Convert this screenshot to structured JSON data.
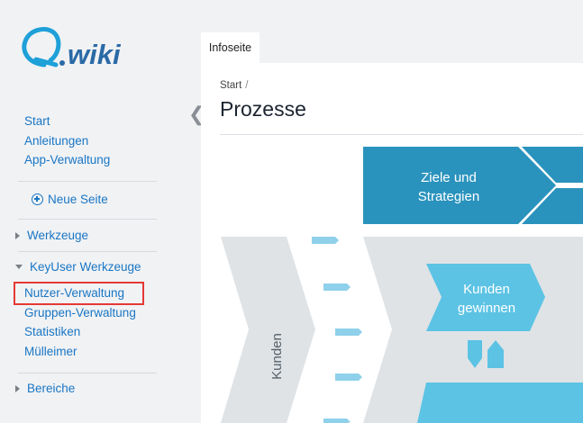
{
  "brand": {
    "logo_text": "Q.wiki"
  },
  "sidebar": {
    "main_links": [
      "Start",
      "Anleitungen",
      "App-Verwaltung"
    ],
    "new_page_label": "Neue Seite",
    "sections": {
      "werkzeuge": "Werkzeuge",
      "keyuser": "KeyUser Werkzeuge",
      "bereiche": "Bereiche"
    },
    "keyuser_items": [
      "Nutzer-Verwaltung",
      "Gruppen-Verwaltung",
      "Statistiken",
      "Mülleimer"
    ],
    "highlighted_item": "Nutzer-Verwaltung"
  },
  "collapse_glyph": "❮",
  "tab": {
    "label": "Infoseite"
  },
  "main": {
    "breadcrumb": {
      "start": "Start",
      "separator": "/"
    },
    "title": "Prozesse"
  },
  "diagram": {
    "goals_line1": "Ziele und",
    "goals_line2": "Strategien",
    "customer_label": "Kunden",
    "win_line1": "Kunden",
    "win_line2": "gewinnen"
  },
  "colors": {
    "link": "#1976c4",
    "highlight": "#e53935",
    "dark_teal": "#2a93bd",
    "light_blue": "#5cc3e4",
    "arrow_blue": "#8fd0ea",
    "grey_band": "#dfe3e6"
  }
}
